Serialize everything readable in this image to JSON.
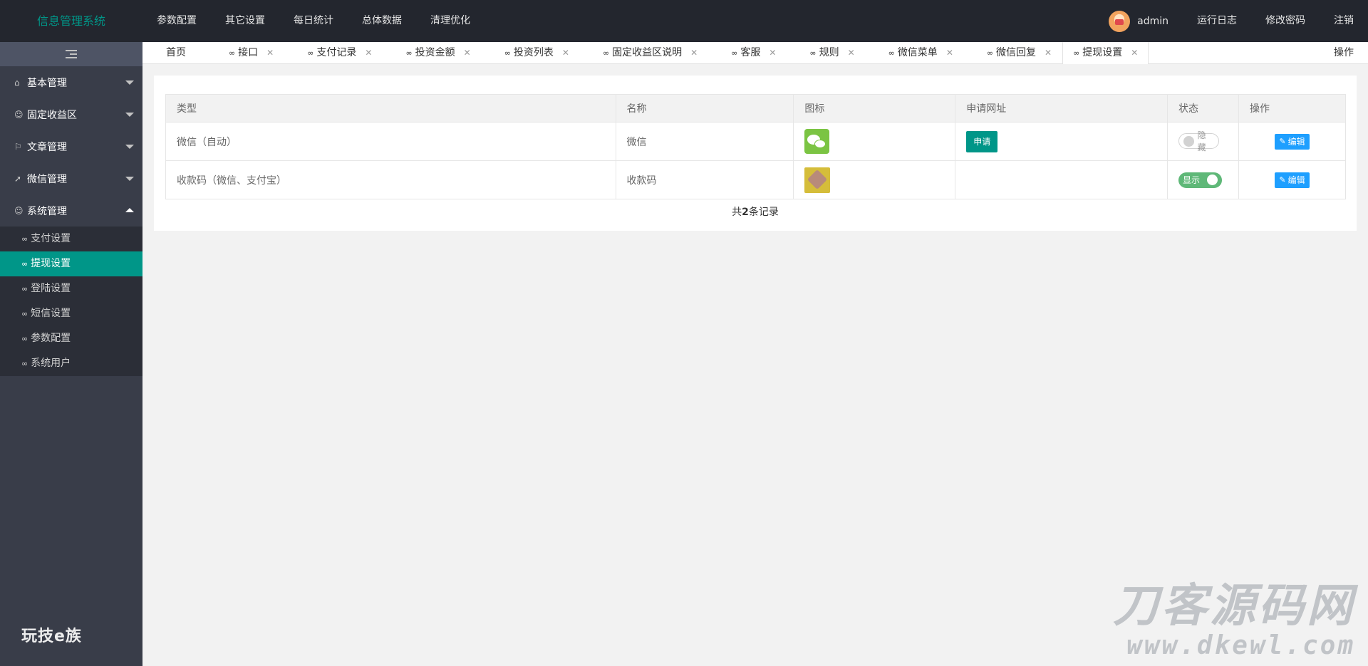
{
  "header": {
    "logo": "信息管理系统",
    "nav": [
      "参数配置",
      "其它设置",
      "每日统计",
      "总体数据",
      "清理优化"
    ],
    "user": "admin",
    "right_items": [
      "运行日志",
      "修改密码",
      "注销"
    ]
  },
  "sidebar": {
    "groups": [
      {
        "label": "基本管理",
        "icon": "home-icon"
      },
      {
        "label": "固定收益区",
        "icon": "user-icon"
      },
      {
        "label": "文章管理",
        "icon": "flag-icon"
      },
      {
        "label": "微信管理",
        "icon": "send-icon"
      },
      {
        "label": "系统管理",
        "icon": "user-icon"
      }
    ],
    "sub_items": [
      "支付设置",
      "提现设置",
      "登陆设置",
      "短信设置",
      "参数配置",
      "系统用户"
    ],
    "active_sub": "提现设置",
    "brand": "玩技e族"
  },
  "tabs": {
    "home": "首页",
    "items": [
      "接口",
      "支付记录",
      "投资金额",
      "投资列表",
      "固定收益区说明",
      "客服",
      "规则",
      "微信菜单",
      "微信回复",
      "提现设置"
    ],
    "active": "提现设置",
    "ops": "操作"
  },
  "table": {
    "headers": [
      "类型",
      "名称",
      "图标",
      "申请网址",
      "状态",
      "操作"
    ],
    "rows": [
      {
        "type": "微信（自动）",
        "name": "微信",
        "icon": "wechat-icon",
        "apply": "申请",
        "status": "隐藏",
        "status_on": false,
        "action": "编辑"
      },
      {
        "type": "收款码（微信、支付宝）",
        "name": "收款码",
        "icon": "qr-code-image",
        "apply": "",
        "status": "显示",
        "status_on": true,
        "action": "编辑"
      }
    ],
    "footer_prefix": "共",
    "footer_count": "2",
    "footer_suffix": "条记录"
  },
  "watermark": {
    "line1": "刀客源码网",
    "line2": "www.dkewl.com"
  },
  "colors": {
    "accent": "#009688",
    "header_bg": "#23262e",
    "sidebar_bg": "#393d49",
    "edit_btn": "#1e9fff",
    "switch_on": "#5fb878"
  }
}
